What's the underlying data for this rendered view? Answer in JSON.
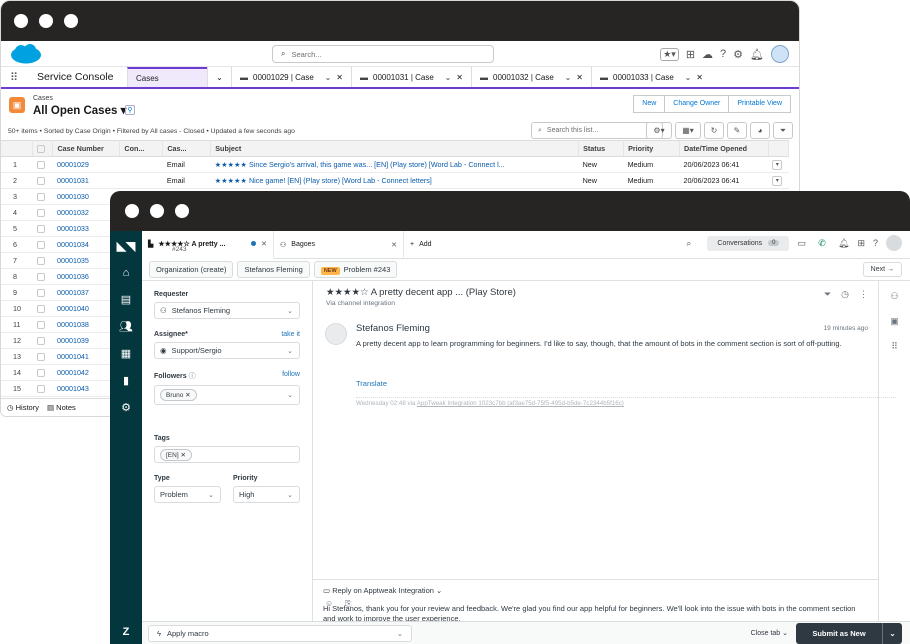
{
  "salesforce": {
    "search_placeholder": "Search...",
    "app_name": "Service Console",
    "tabs": [
      {
        "label": "Cases"
      },
      {
        "label": "00001029 | Case"
      },
      {
        "label": "00001031 | Case"
      },
      {
        "label": "00001032 | Case"
      },
      {
        "label": "00001033 | Case"
      }
    ],
    "object_label": "Cases",
    "view_name": "All Open Cases",
    "buttons": {
      "new": "New",
      "change_owner": "Change Owner",
      "printable_view": "Printable View"
    },
    "meta": "50+ items • Sorted by Case Origin • Filtered by All cases - Closed • Updated a few seconds ago",
    "list_search_placeholder": "Search this list...",
    "columns": [
      "Case Number",
      "Con...",
      "Cas...",
      "Subject",
      "Status",
      "Priority",
      "Date/Time Opened"
    ],
    "rows": [
      {
        "n": "1",
        "case": "00001029",
        "origin": "Email",
        "subject": "★★★★★ Since Sergio's arrival, this game was... [EN] (Play store) [Word Lab - Connect l...",
        "status": "New",
        "priority": "Medium",
        "opened": "20/06/2023 06:41"
      },
      {
        "n": "2",
        "case": "00001031",
        "origin": "Email",
        "subject": "★★★★★ Nice game! [EN] (Play store) [Word Lab - Connect letters]",
        "status": "New",
        "priority": "Medium",
        "opened": "20/06/2023 06:41"
      },
      {
        "n": "3",
        "case": "00001030"
      },
      {
        "n": "4",
        "case": "00001032"
      },
      {
        "n": "5",
        "case": "00001033"
      },
      {
        "n": "6",
        "case": "00001034"
      },
      {
        "n": "7",
        "case": "00001035"
      },
      {
        "n": "8",
        "case": "00001036"
      },
      {
        "n": "9",
        "case": "00001037"
      },
      {
        "n": "10",
        "case": "00001040"
      },
      {
        "n": "11",
        "case": "00001038"
      },
      {
        "n": "12",
        "case": "00001039"
      },
      {
        "n": "13",
        "case": "00001041"
      },
      {
        "n": "14",
        "case": "00001042"
      },
      {
        "n": "15",
        "case": "00001043"
      }
    ],
    "utility": {
      "history": "History",
      "notes": "Notes"
    }
  },
  "zendesk": {
    "tab1": {
      "title": "★★★★☆ A pretty ...",
      "sub": "#243"
    },
    "tab2": {
      "title": "Bagoes"
    },
    "add_label": "Add",
    "conversations": {
      "label": "Conversations",
      "count": "0"
    },
    "crumbs": {
      "org": "Organization (create)",
      "user": "Stefanos Fleming",
      "badge": "NEW",
      "ticket": "Problem #243"
    },
    "next_label": "Next",
    "fields": {
      "requester_label": "Requester",
      "requester": "Stefanos Fleming",
      "assignee_label": "Assignee*",
      "take_it": "take it",
      "assignee": "Support/Sergio",
      "followers_label": "Followers",
      "follow": "follow",
      "follower": "Bruno",
      "tags_label": "Tags",
      "tag": "[EN]",
      "type_label": "Type",
      "type": "Problem",
      "priority_label": "Priority",
      "priority": "High"
    },
    "ticket": {
      "title": "★★★★☆ A pretty decent app ... (Play Store)",
      "via": "Via channel integration",
      "author": "Stefanos Fleming",
      "time": "19 minutes ago",
      "body": "A pretty decent app to learn programming for beginners. I'd like to say, though, that the amount of bots in the comment section is sort of off-putting.",
      "translate": "Translate",
      "footer_prefix": "Wednesday 02:48 via ",
      "footer_link": "AppTweak Integration 1023c7bb (af3ae75d-75f5-495d-b5de-7c2344b5f16c)"
    },
    "reply": {
      "header": "Reply on Apptweak Integration",
      "text": "Hi Stefanos, thank you for your review and feedback. We're glad you find our app helpful for beginners. We'll look into the issue with bots in the comment section and work to improve the user experience."
    },
    "footer": {
      "macro": "Apply macro",
      "close_tab": "Close tab",
      "submit": "Submit as New"
    }
  },
  "colors": {
    "salesforce_accent": "#6c3bd1",
    "zendesk_rail": "#03363d",
    "link": "#0b5cab",
    "cases_icon": "#f38a3a"
  }
}
